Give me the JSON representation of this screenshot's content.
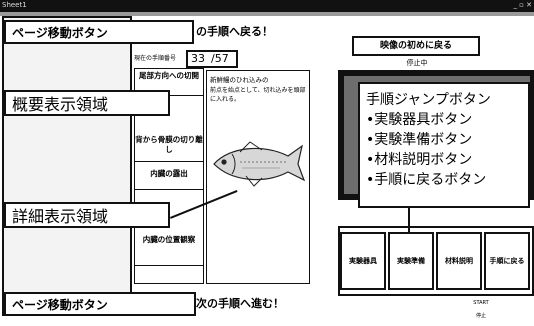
{
  "titlebar": {
    "left_text": "Sheet1",
    "right_text": "_ ▫ ✕"
  },
  "nav": {
    "prev_label": "ページ移動ボタン",
    "prev_sub": "の手順へ戻る！",
    "next_label": "ページ移動ボタン",
    "next_sub": "次の手順へ進む！"
  },
  "counter": {
    "label": "現在の手順番号",
    "current": "33",
    "total": "/57"
  },
  "overview": {
    "items": [
      {
        "label": "尾部方向への切開"
      },
      {
        "label": "背から骨膜の切り離し"
      },
      {
        "label": "内臓の露出"
      },
      {
        "label": "内臓の位置観察"
      }
    ]
  },
  "detail": {
    "title": "新鮮鰻のひれ込みの",
    "text": "前点を始点として、切れ込みを頭部に入れる。"
  },
  "callouts": {
    "overview_area": "概要表示領域",
    "detail_area": "詳細表示領域"
  },
  "video": {
    "restart_label": "映像の初めに戻る",
    "status": "停止中"
  },
  "jump": {
    "callout_title": "手順ジャンプボタン",
    "items": [
      "•実験器具ボタン",
      "•実験準備ボタン",
      "•材料説明ボタン",
      "•手順に戻るボタン"
    ],
    "buttons": [
      "実験器具",
      "実験準備",
      "材料説明",
      "手順に戻る"
    ]
  },
  "playback": {
    "start": "START",
    "stop": "停止"
  }
}
